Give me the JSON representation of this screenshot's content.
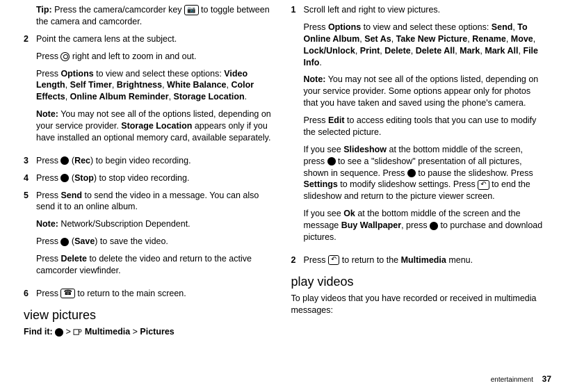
{
  "left": {
    "tip_label": "Tip:",
    "tip_a": " Press the camera/camcorder key ",
    "tip_b": " to toggle between the camera and camcorder.",
    "s2_num": "2",
    "s2_a": "Point the camera lens at the subject.",
    "s2_b1": "Press ",
    "s2_b2": " right and left to zoom in and out.",
    "s2_c1": "Press ",
    "s2_c_opt": "Options",
    "s2_c2": " to view and select these options: ",
    "s2_opts": "Video Length",
    "s2_opts2": ", ",
    "s2_o2": "Self Timer",
    "s2_o3": "Brightness",
    "s2_o4": "White Balance",
    "s2_o5": "Color Effects",
    "s2_o6": "Online Album Reminder",
    "s2_o7": "Storage Location",
    "s2_note_label": "Note:",
    "s2_note_a": " You may not see all of the options listed, depending on your service provider. ",
    "s2_note_b": "Storage Location",
    "s2_note_c": " appears only if you have installed an optional memory card, available separately.",
    "s3_num": "3",
    "s3_a": "Press ",
    "s3_b": "Rec",
    "s3_c": ") to begin video recording.",
    "s4_num": "4",
    "s4_a": "Press ",
    "s4_b": "Stop",
    "s4_c": ") to stop video recording.",
    "s5_num": "5",
    "s5_a": "Press ",
    "s5_b": "Send",
    "s5_c": " to send the video in a message. You can also send it to an online album.",
    "s5_note_label": "Note:",
    "s5_note_a": " Network/Subscription Dependent.",
    "s5_d": "Press ",
    "s5_e": "Save",
    "s5_f": ") to save the video.",
    "s5_g": "Press ",
    "s5_h": "Delete",
    "s5_i": " to delete the video and return to the active camcorder viewfinder.",
    "s6_num": "6",
    "s6_a": "Press ",
    "s6_b": " to return to the main screen.",
    "h2": "view pictures",
    "findit_a": "Find it:",
    "findit_b": " > ",
    "findit_c": "Multimedia",
    "findit_d": " > ",
    "findit_e": "Pictures"
  },
  "right": {
    "s1_num": "1",
    "s1_a": "Scroll left and right to view pictures.",
    "s1_b1": "Press ",
    "s1_b_opt": "Options",
    "s1_b2": " to view and select these options: ",
    "o1": "Send",
    "o2": "To Online Album",
    "o3": "Set As",
    "o4": "Take New Picture",
    "o5": "Rename",
    "o6": "Move",
    "o7": "Lock/Unlock",
    "o8": "Print",
    "o9": "Delete",
    "o10": "Delete All",
    "o11": "Mark",
    "o12": "Mark All",
    "o13": "File Info",
    "sep": ", ",
    "dot": ".",
    "note_label": "Note:",
    "note_body": " You may not see all of the options listed, depending on your service provider. Some options appear only for photos that you have taken and saved using the phone's camera.",
    "edit_a": "Press ",
    "edit_b": "Edit",
    "edit_c": " to access editing tools that you can use to modify the selected picture.",
    "ss_a": "If you see ",
    "ss_b": "Slideshow",
    "ss_c": " at the bottom middle of the screen, press ",
    "ss_d": " to see a \"slideshow\" presentation of all pictures, shown in sequence. Press ",
    "ss_e": " to pause the slideshow. Press ",
    "ss_f": "Settings",
    "ss_g": " to modify slideshow settings. Press ",
    "ss_h": " to end the slideshow and return to the picture viewer screen.",
    "bw_a": "If you see ",
    "bw_b": "Ok",
    "bw_c": " at the bottom middle of the screen and the message ",
    "bw_d": "Buy Wallpaper",
    "bw_e": ", press ",
    "bw_f": " to purchase and download pictures.",
    "s2_num": "2",
    "s2_a": "Press ",
    "s2_b": " to return to the ",
    "s2_c": "Multimedia",
    "s2_d": " menu.",
    "h2": "play videos",
    "pv_a": "To play videos that you have recorded or received in multimedia messages:"
  },
  "footer": {
    "section": "entertainment",
    "page": "37"
  },
  "glyphs": {
    "camera": "📷",
    "back": "↶",
    "end": "☎"
  }
}
